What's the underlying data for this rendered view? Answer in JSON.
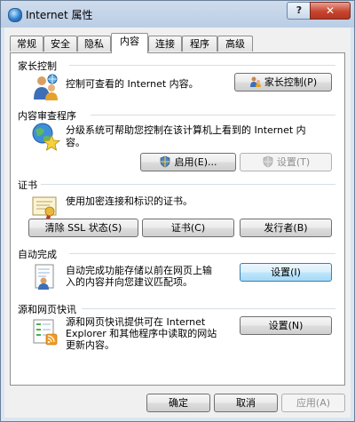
{
  "window": {
    "title": "Internet 属性",
    "help_label": "?",
    "close_label": "✕"
  },
  "tabs": [
    {
      "label": "常规"
    },
    {
      "label": "安全"
    },
    {
      "label": "隐私"
    },
    {
      "label": "内容"
    },
    {
      "label": "连接"
    },
    {
      "label": "程序"
    },
    {
      "label": "高级"
    }
  ],
  "sections": {
    "parental": {
      "title": "家长控制",
      "desc": "控制可查看的 Internet 内容。",
      "button": "家长控制(P)"
    },
    "advisor": {
      "title": "内容审查程序",
      "desc_line1": "分级系统可帮助您控制在该计算机上看到的 Internet 内",
      "desc_line2": "容。",
      "enable_button": "启用(E)...",
      "settings_button": "设置(T)"
    },
    "certificates": {
      "title": "证书",
      "desc": "使用加密连接和标识的证书。",
      "clear_ssl_button": "清除 SSL 状态(S)",
      "certificates_button": "证书(C)",
      "publishers_button": "发行者(B)"
    },
    "autocomplete": {
      "title": "自动完成",
      "desc_line1": "自动完成功能存储以前在网页上输",
      "desc_line2": "入的内容并向您建议匹配项。",
      "settings_button": "设置(I)"
    },
    "feeds": {
      "title": "源和网页快讯",
      "desc_line1": "源和网页快讯提供可在 Internet",
      "desc_line2": "Explorer 和其他程序中读取的网站",
      "desc_line3": "更新内容。",
      "settings_button": "设置(N)"
    }
  },
  "footer": {
    "ok": "确定",
    "cancel": "取消",
    "apply": "应用(A)"
  }
}
